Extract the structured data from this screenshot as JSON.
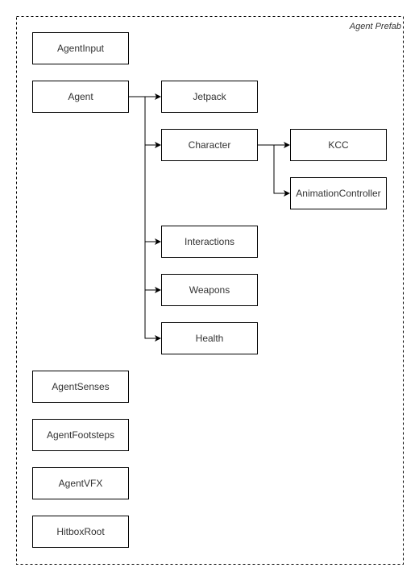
{
  "container": {
    "label": "Agent Prefab"
  },
  "nodes": {
    "agent_input": "AgentInput",
    "agent": "Agent",
    "jetpack": "Jetpack",
    "character": "Character",
    "kcc": "KCC",
    "animation_controller": "AnimationController",
    "interactions": "Interactions",
    "weapons": "Weapons",
    "health": "Health",
    "agent_senses": "AgentSenses",
    "agent_footsteps": "AgentFootsteps",
    "agent_vfx": "AgentVFX",
    "hitbox_root": "HitboxRoot"
  },
  "edges": [
    {
      "from": "Agent",
      "to": "Jetpack"
    },
    {
      "from": "Agent",
      "to": "Character"
    },
    {
      "from": "Agent",
      "to": "Interactions"
    },
    {
      "from": "Agent",
      "to": "Weapons"
    },
    {
      "from": "Agent",
      "to": "Health"
    },
    {
      "from": "Character",
      "to": "KCC"
    },
    {
      "from": "Character",
      "to": "AnimationController"
    }
  ]
}
